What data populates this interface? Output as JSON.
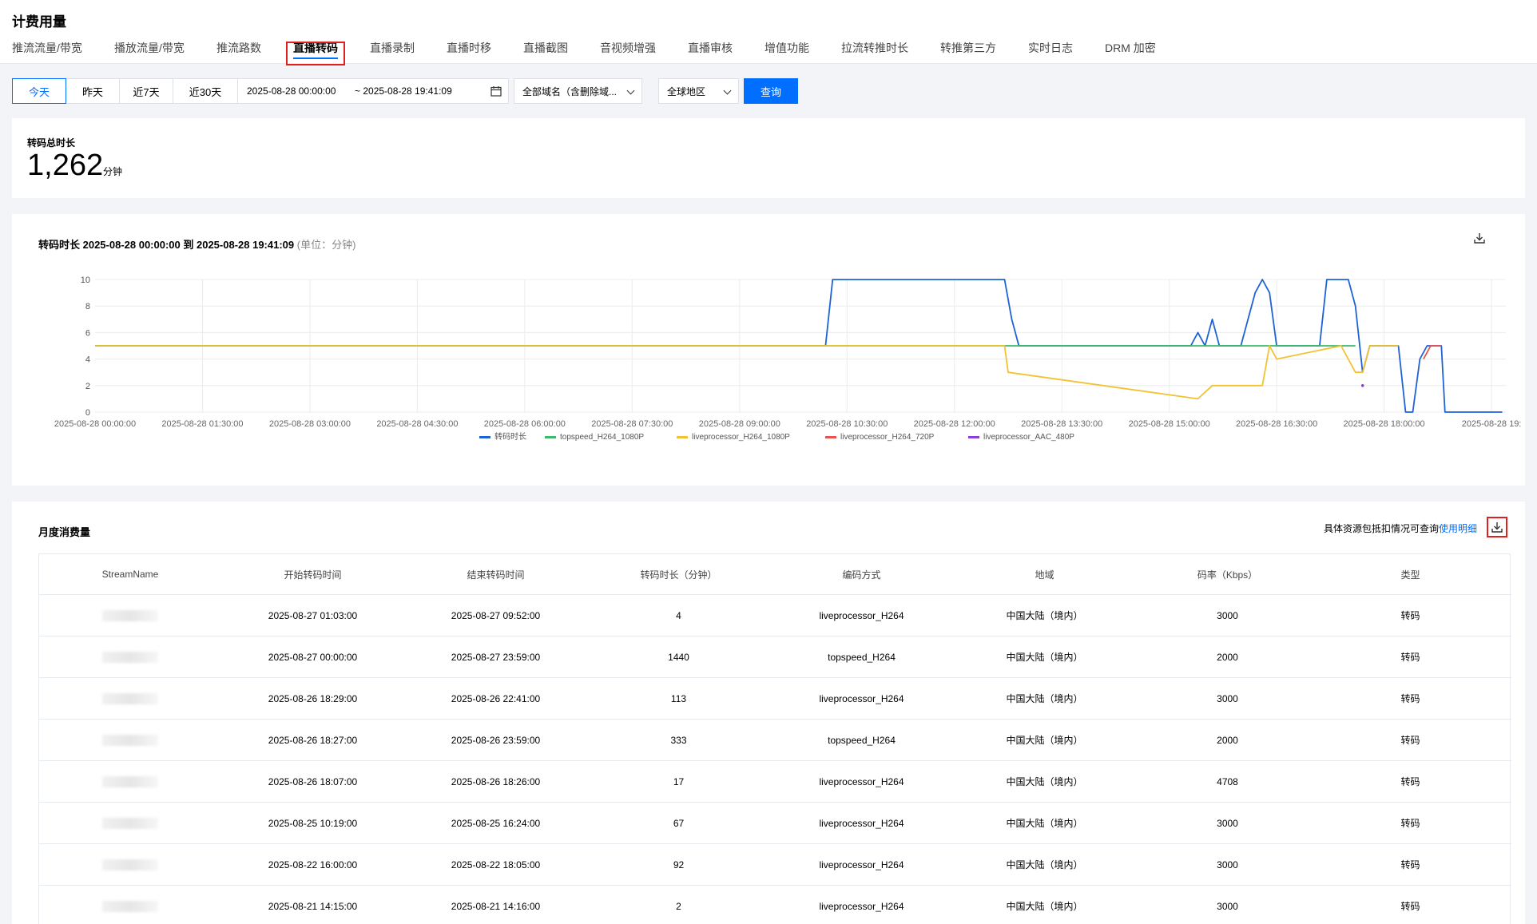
{
  "page": {
    "title": "计费用量"
  },
  "tabs": [
    {
      "label": "推流流量/带宽"
    },
    {
      "label": "播放流量/带宽"
    },
    {
      "label": "推流路数"
    },
    {
      "label": "直播转码"
    },
    {
      "label": "直播录制"
    },
    {
      "label": "直播时移"
    },
    {
      "label": "直播截图"
    },
    {
      "label": "音视频增强"
    },
    {
      "label": "直播审核"
    },
    {
      "label": "增值功能"
    },
    {
      "label": "拉流转推时长"
    },
    {
      "label": "转推第三方"
    },
    {
      "label": "实时日志"
    },
    {
      "label": "DRM 加密"
    }
  ],
  "active_tab": "直播转码",
  "filters": {
    "quick_ranges": [
      {
        "label": "今天"
      },
      {
        "label": "昨天"
      },
      {
        "label": "近7天"
      },
      {
        "label": "近30天"
      }
    ],
    "active_range": "今天",
    "start": "2025-08-28 00:00:00",
    "end": "~ 2025-08-28 19:41:09",
    "domain_select": "全部域名（含删除域...",
    "region_select": "全球地区",
    "query_button": "查询"
  },
  "summary": {
    "label": "转码总时长",
    "value": "1,262",
    "unit": "分钟"
  },
  "chart_card": {
    "title": "转码时长 2025-08-28 00:00:00 到 2025-08-28 19:41:09",
    "unit_note": "(单位：分钟)"
  },
  "chart_data": {
    "type": "line",
    "x_tick_labels": [
      "2025-08-28 00:00:00",
      "2025-08-28 01:30:00",
      "2025-08-28 03:00:00",
      "2025-08-28 04:30:00",
      "2025-08-28 06:00:00",
      "2025-08-28 07:30:00",
      "2025-08-28 09:00:00",
      "2025-08-28 10:30:00",
      "2025-08-28 12:00:00",
      "2025-08-28 13:30:00",
      "2025-08-28 15:00:00",
      "2025-08-28 16:30:00",
      "2025-08-28 18:00:00",
      "2025-08-28 19:"
    ],
    "x_unit": "hours since 2025-08-28 00:00",
    "xlim": [
      0,
      19.7
    ],
    "ylim": [
      0,
      10
    ],
    "y_ticks": [
      0,
      2,
      4,
      6,
      8,
      10
    ],
    "grid": true,
    "legend_position": "bottom",
    "series": [
      {
        "name": "转码时长",
        "color": "#1e63d6",
        "points": [
          [
            0,
            5
          ],
          [
            10.2,
            5
          ],
          [
            10.3,
            10
          ],
          [
            12.7,
            10
          ],
          [
            12.8,
            7
          ],
          [
            12.9,
            5
          ],
          [
            15.3,
            5
          ],
          [
            15.4,
            6
          ],
          [
            15.5,
            5
          ],
          [
            15.6,
            7
          ],
          [
            15.7,
            5
          ],
          [
            16.0,
            5
          ],
          [
            16.2,
            9
          ],
          [
            16.3,
            10
          ],
          [
            16.4,
            9
          ],
          [
            16.5,
            5
          ],
          [
            17.1,
            5
          ],
          [
            17.2,
            10
          ],
          [
            17.5,
            10
          ],
          [
            17.6,
            8
          ],
          [
            17.7,
            3
          ],
          [
            17.8,
            5
          ],
          [
            18.2,
            5
          ],
          [
            18.3,
            0
          ],
          [
            18.4,
            0
          ],
          [
            18.5,
            4
          ],
          [
            18.6,
            5
          ],
          [
            18.8,
            5
          ],
          [
            18.85,
            0
          ],
          [
            19.65,
            0
          ]
        ]
      },
      {
        "name": "topspeed_H264_1080P",
        "color": "#3cba6a",
        "points": [
          [
            0,
            5
          ],
          [
            17.6,
            5
          ]
        ]
      },
      {
        "name": "liveprocessor_H264_1080P",
        "color": "#f2c232",
        "points": [
          [
            0,
            5
          ],
          [
            12.7,
            5
          ],
          [
            12.75,
            3
          ],
          [
            15.4,
            1
          ],
          [
            15.6,
            2
          ],
          [
            16.3,
            2
          ],
          [
            16.4,
            5
          ],
          [
            16.5,
            4
          ],
          [
            17.4,
            5
          ],
          [
            17.6,
            3
          ],
          [
            17.7,
            3
          ],
          [
            17.8,
            5
          ],
          [
            18.2,
            5
          ]
        ]
      },
      {
        "name": "liveprocessor_H264_720P",
        "color": "#e55252",
        "points": [
          [
            18.55,
            4
          ],
          [
            18.65,
            5
          ],
          [
            18.8,
            5
          ]
        ]
      },
      {
        "name": "liveprocessor_AAC_480P",
        "color": "#8b3fd6",
        "points": [
          [
            17.7,
            2
          ]
        ]
      }
    ]
  },
  "monthly": {
    "title": "月度消费量",
    "note": "具体资源包抵扣情况可查询",
    "note_link": "使用明细",
    "columns": [
      "StreamName",
      "开始转码时间",
      "结束转码时间",
      "转码时长（分钟）",
      "编码方式",
      "地域",
      "码率（Kbps）",
      "类型"
    ],
    "rows": [
      [
        "",
        "2025-08-27 01:03:00",
        "2025-08-27 09:52:00",
        "4",
        "liveprocessor_H264",
        "中国大陆（境内）",
        "3000",
        "转码"
      ],
      [
        "",
        "2025-08-27 00:00:00",
        "2025-08-27 23:59:00",
        "1440",
        "topspeed_H264",
        "中国大陆（境内）",
        "2000",
        "转码"
      ],
      [
        "",
        "2025-08-26 18:29:00",
        "2025-08-26 22:41:00",
        "113",
        "liveprocessor_H264",
        "中国大陆（境内）",
        "3000",
        "转码"
      ],
      [
        "",
        "2025-08-26 18:27:00",
        "2025-08-26 23:59:00",
        "333",
        "topspeed_H264",
        "中国大陆（境内）",
        "2000",
        "转码"
      ],
      [
        "",
        "2025-08-26 18:07:00",
        "2025-08-26 18:26:00",
        "17",
        "liveprocessor_H264",
        "中国大陆（境内）",
        "4708",
        "转码"
      ],
      [
        "",
        "2025-08-25 10:19:00",
        "2025-08-25 16:24:00",
        "67",
        "liveprocessor_H264",
        "中国大陆（境内）",
        "3000",
        "转码"
      ],
      [
        "",
        "2025-08-22 16:00:00",
        "2025-08-22 18:05:00",
        "92",
        "liveprocessor_H264",
        "中国大陆（境内）",
        "3000",
        "转码"
      ],
      [
        "",
        "2025-08-21 14:15:00",
        "2025-08-21 14:16:00",
        "2",
        "liveprocessor_H264",
        "中国大陆（境内）",
        "3000",
        "转码"
      ]
    ]
  },
  "icons": {
    "download": "download-icon",
    "calendar": "calendar-icon",
    "chevron": "chevron-down-icon"
  },
  "colors": {
    "accent": "#006eff",
    "highlight_border": "#e02020"
  }
}
